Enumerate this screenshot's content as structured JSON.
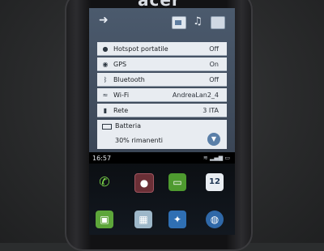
{
  "brand": "acer",
  "notification_shade": {
    "toggles": [
      {
        "icon": "hotspot-icon",
        "label": "Hotspot portatile",
        "value": "Off"
      },
      {
        "icon": "gps-icon",
        "label": "GPS",
        "value": "On"
      },
      {
        "icon": "bluetooth-icon",
        "label": "Bluetooth",
        "value": "Off"
      },
      {
        "icon": "wifi-icon",
        "label": "Wi-Fi",
        "value": "AndreaLan2_4"
      },
      {
        "icon": "signal-icon",
        "label": "Rete",
        "value": "3 ITA"
      }
    ],
    "battery": {
      "label": "Batteria",
      "value": "30% rimanenti"
    }
  },
  "status_bar": {
    "time": "16:57"
  },
  "home_apps": {
    "calendar_day": "12"
  },
  "colors": {
    "shade_bg": "#4b5a6d",
    "row_bg": "#e8ecf1",
    "accent_blue": "#5a7fa8"
  }
}
